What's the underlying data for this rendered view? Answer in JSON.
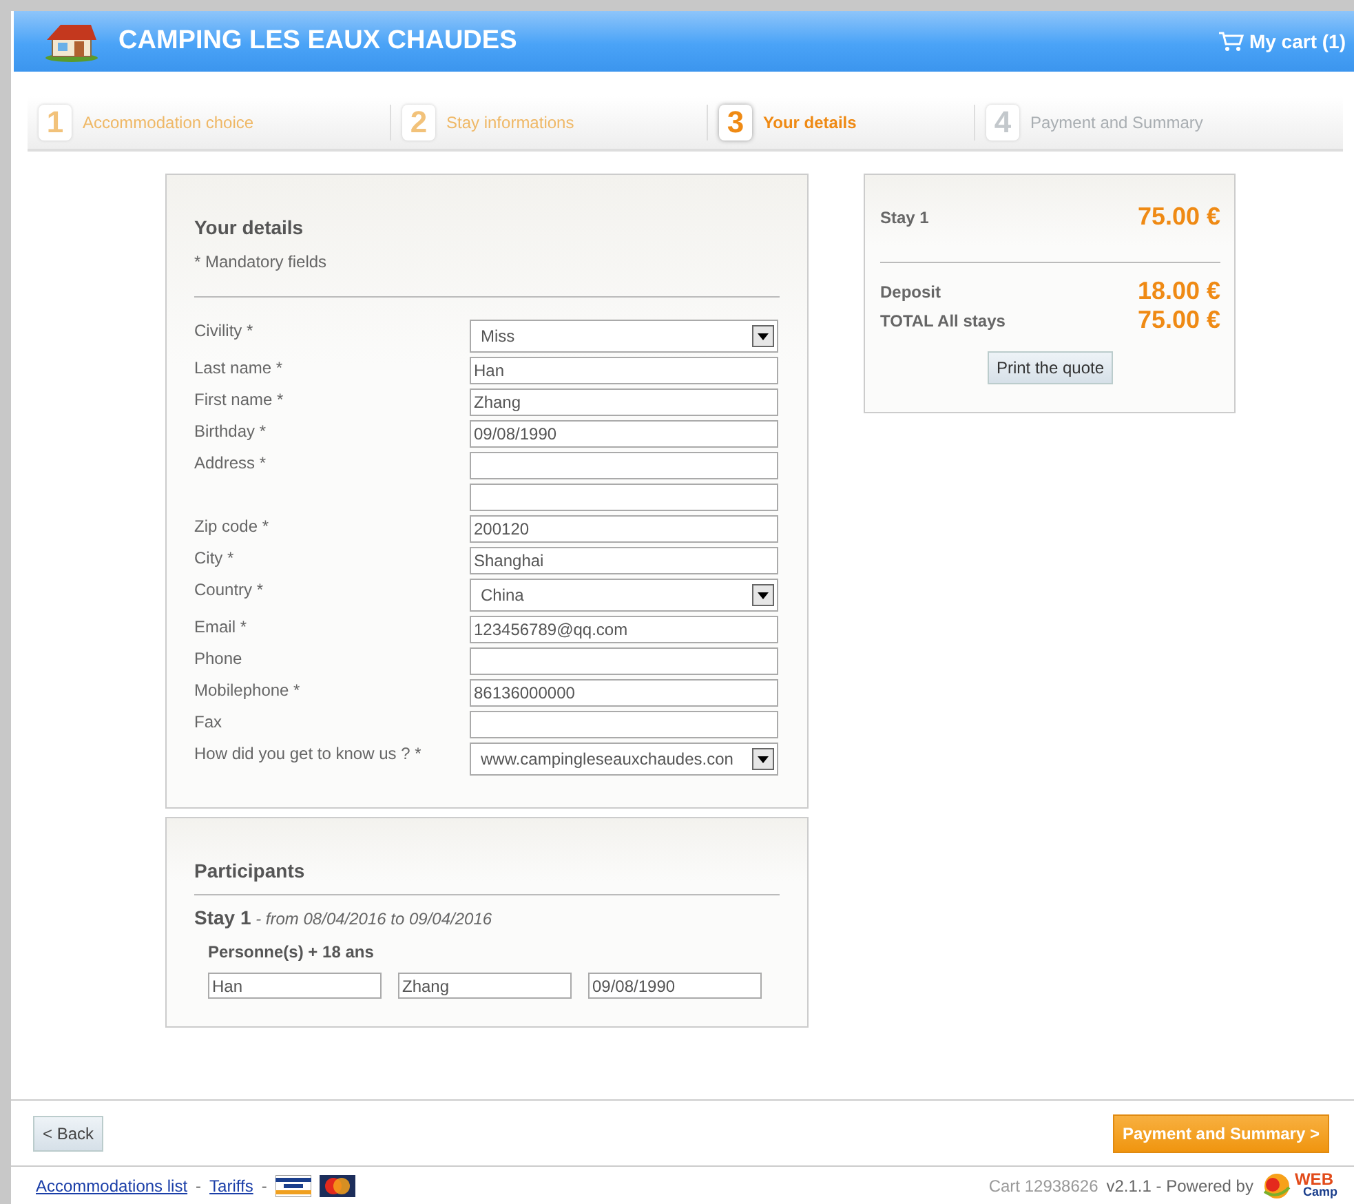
{
  "header": {
    "title": "CAMPING LES EAUX CHAUDES",
    "cart": "My cart (1)"
  },
  "steps": [
    {
      "number": "1",
      "label": "Accommodation choice",
      "selected": false,
      "disabled": false
    },
    {
      "number": "2",
      "label": "Stay informations",
      "selected": false,
      "disabled": false
    },
    {
      "number": "3",
      "label": "Your details",
      "selected": true,
      "disabled": false
    },
    {
      "number": "4",
      "label": "Payment and Summary",
      "selected": false,
      "disabled": true
    }
  ],
  "details": {
    "title": "Your details",
    "note": "* Mandatory fields",
    "fields": [
      {
        "label": "Civility *",
        "kind": "select",
        "value": "Miss"
      },
      {
        "label": "Last name *",
        "kind": "text",
        "value": "Han"
      },
      {
        "label": "First name *",
        "kind": "text",
        "value": "Zhang"
      },
      {
        "label": "Birthday *",
        "kind": "text",
        "value": "09/08/1990"
      },
      {
        "label": "Address *",
        "kind": "text"
      },
      {
        "kind": "text"
      },
      {
        "label": "Zip code *",
        "kind": "text",
        "value": "200120"
      },
      {
        "label": "City *",
        "kind": "text",
        "value": "Shanghai"
      },
      {
        "label": "Country *",
        "kind": "select",
        "value": "China"
      },
      {
        "label": "Email *",
        "kind": "text",
        "value": "123456789@qq.com"
      },
      {
        "label": "Phone",
        "kind": "text"
      },
      {
        "label": "Mobilephone *",
        "kind": "text",
        "value": "86136000000"
      },
      {
        "label": "Fax",
        "kind": "text"
      },
      {
        "label": "How did you get to know us ? *",
        "kind": "select",
        "value": "www.campingleseauxchaudes.con"
      }
    ]
  },
  "participants": {
    "title": "Participants",
    "stay": "Stay 1",
    "dates": "- from 08/04/2016 to 09/04/2016",
    "group": "Personne(s) + 18 ans",
    "values": [
      "Han",
      "Zhang",
      "09/08/1990"
    ]
  },
  "summary": {
    "stay": {
      "label": "Stay 1",
      "amount": "75.00 €"
    },
    "lines": [
      {
        "label": "Deposit",
        "amount": "18.00 €"
      },
      {
        "label": "TOTAL All stays",
        "amount": "75.00 €"
      }
    ],
    "button": "Print the quote"
  },
  "nav": {
    "back": "< Back",
    "next": "Payment and Summary >"
  },
  "footer": {
    "links": [
      "Accommodations list",
      "Tariffs"
    ],
    "separators": [
      "-",
      "-"
    ],
    "cart": "Cart 12938626",
    "version": "v2.1.1 - Powered by",
    "logo": [
      "WEB",
      "Camp"
    ]
  }
}
